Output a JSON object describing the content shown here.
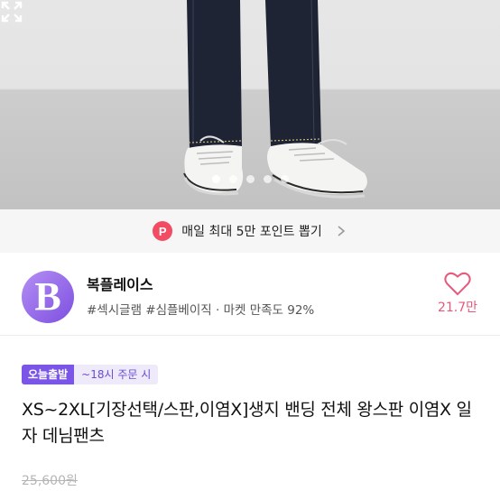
{
  "gallery": {
    "slide_count": 5,
    "active_index": 0,
    "expand_icon": "expand-icon"
  },
  "banner": {
    "badge": "P",
    "text": "매일 최대 5만 포인트 뽑기",
    "chevron_icon": "chevron-right-icon"
  },
  "shop": {
    "logo_letter": "B",
    "name": "복플레이스",
    "meta": "#섹시글램 #심플베이직 · 마켓 만족도 92%",
    "likes": "21.7만",
    "accent_color": "#e8587a"
  },
  "product": {
    "badge_today": "오늘출발",
    "badge_time": "~18시 주문 시",
    "title": "XS~2XL[기장선택/스판,이염X]생지 밴딩 전체 왕스판 이염X 일자 데님팬츠",
    "original_price": "25,600원"
  }
}
